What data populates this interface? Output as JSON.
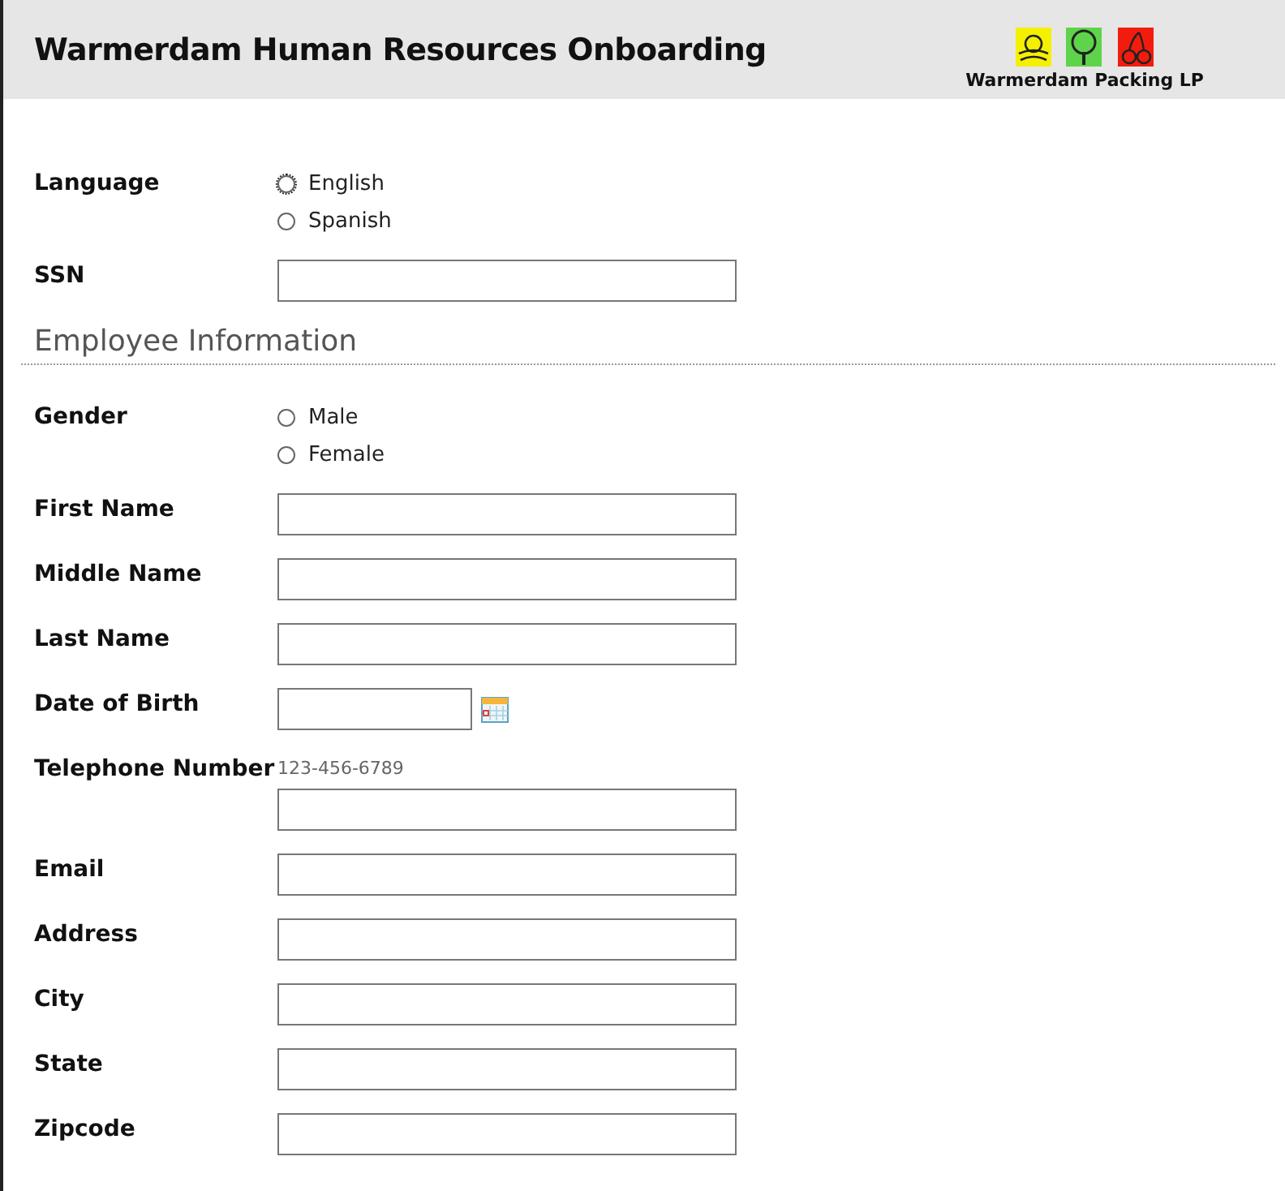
{
  "header": {
    "title": "Warmerdam Human Resources Onboarding",
    "logo_caption": "Warmerdam Packing LP"
  },
  "items": [
    {
      "kind": "radio",
      "label": "Language",
      "options": [
        {
          "label": "English",
          "selected": false,
          "focused": true
        },
        {
          "label": "Spanish",
          "selected": false,
          "focused": false
        }
      ]
    },
    {
      "kind": "text",
      "label": "SSN"
    },
    {
      "kind": "section",
      "label": "Employee Information"
    },
    {
      "kind": "radio",
      "label": "Gender",
      "options": [
        {
          "label": "Male",
          "selected": false,
          "focused": false
        },
        {
          "label": "Female",
          "selected": false,
          "focused": false
        }
      ]
    },
    {
      "kind": "text",
      "label": "First Name"
    },
    {
      "kind": "text",
      "label": "Middle Name"
    },
    {
      "kind": "text",
      "label": "Last Name"
    },
    {
      "kind": "date",
      "label": "Date of Birth"
    },
    {
      "kind": "hinted",
      "label": "Telephone Number",
      "hint": "123-456-6789"
    },
    {
      "kind": "text",
      "label": "Email"
    },
    {
      "kind": "text",
      "label": "Address"
    },
    {
      "kind": "text",
      "label": "City"
    },
    {
      "kind": "text",
      "label": "State"
    },
    {
      "kind": "text",
      "label": "Zipcode"
    }
  ]
}
